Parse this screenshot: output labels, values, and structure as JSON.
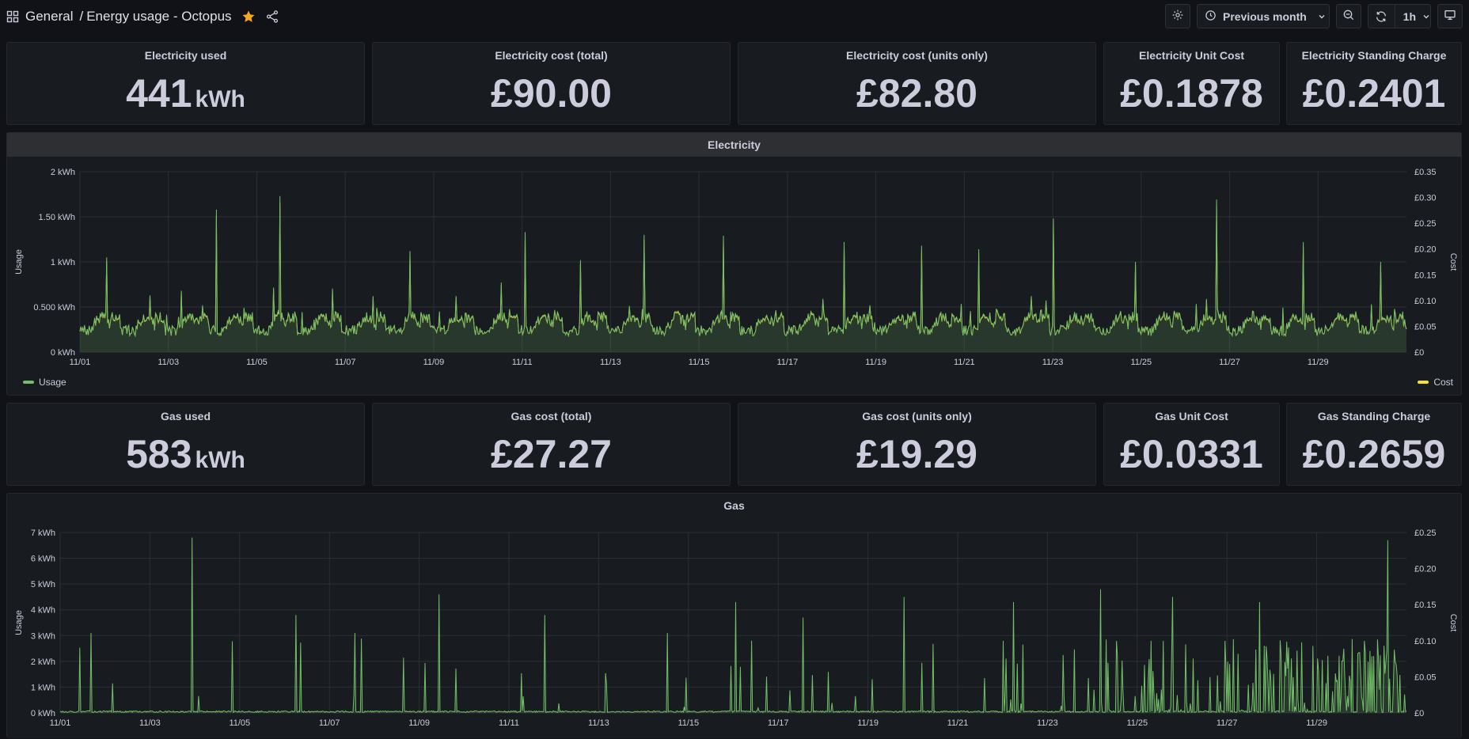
{
  "header": {
    "folder": "General",
    "separator": "/",
    "dashboard_title": "Energy usage - Octopus",
    "time_range_label": "Previous month",
    "refresh_interval": "1h",
    "icons": [
      "grid-icon",
      "star-icon",
      "share-icon",
      "gear-icon",
      "clock-icon",
      "zoom-out-icon",
      "refresh-icon",
      "tv-icon"
    ],
    "star_color": "#f5a623"
  },
  "electricity_stats": [
    {
      "title": "Electricity used",
      "value": "441",
      "unit": "kWh"
    },
    {
      "title": "Electricity cost (total)",
      "value": "£90.00",
      "unit": ""
    },
    {
      "title": "Electricity cost (units only)",
      "value": "£82.80",
      "unit": ""
    },
    {
      "title": "Electricity Unit Cost",
      "value": "£0.1878",
      "unit": ""
    },
    {
      "title": "Electricity Standing Charge",
      "value": "£0.2401",
      "unit": ""
    }
  ],
  "gas_stats": [
    {
      "title": "Gas used",
      "value": "583",
      "unit": "kWh"
    },
    {
      "title": "Gas cost (total)",
      "value": "£27.27",
      "unit": ""
    },
    {
      "title": "Gas cost (units only)",
      "value": "£19.29",
      "unit": ""
    },
    {
      "title": "Gas Unit Cost",
      "value": "£0.0331",
      "unit": ""
    },
    {
      "title": "Gas Standing Charge",
      "value": "£0.2659",
      "unit": ""
    }
  ],
  "colors": {
    "usage": "#73bf69",
    "cost": "#fade2a",
    "usage_fill": "rgba(115,191,105,0.18)"
  },
  "chart_data": [
    {
      "type": "area",
      "title": "Electricity",
      "xlabel": "",
      "ylabel": "Usage",
      "ylabel_right": "Cost",
      "x_range": [
        "11/01",
        "11/30"
      ],
      "x_ticks": [
        "11/01",
        "11/03",
        "11/05",
        "11/07",
        "11/09",
        "11/11",
        "11/13",
        "11/15",
        "11/17",
        "11/19",
        "11/21",
        "11/23",
        "11/25",
        "11/27",
        "11/29"
      ],
      "y_ticks": [
        "0 kWh",
        "0.500 kWh",
        "1 kWh",
        "1.50 kWh",
        "2 kWh"
      ],
      "ylim": [
        0,
        2
      ],
      "y2_ticks": [
        "£0",
        "£0.05",
        "£0.10",
        "£0.15",
        "£0.20",
        "£0.25",
        "£0.30",
        "£0.35"
      ],
      "y2lim": [
        0,
        0.35
      ],
      "legend_placement": "bottom",
      "series": [
        {
          "name": "Usage",
          "axis": "left",
          "color": "#73bf69",
          "baseline": 0.3,
          "peaks_kwh": [
            1.05,
            1.58,
            1.73,
            0.62,
            1.12,
            1.33,
            1.02,
            1.3,
            1.29,
            1.22,
            1.18,
            1.14,
            1.48,
            1.0,
            1.69,
            1.22,
            1.0
          ]
        },
        {
          "name": "Cost",
          "axis": "right",
          "color": "#fade2a"
        }
      ]
    },
    {
      "type": "area",
      "title": "Gas",
      "xlabel": "",
      "ylabel": "Usage",
      "ylabel_right": "Cost",
      "x_range": [
        "11/01",
        "11/30"
      ],
      "x_ticks": [
        "11/01",
        "11/03",
        "11/05",
        "11/07",
        "11/09",
        "11/11",
        "11/13",
        "11/15",
        "11/17",
        "11/19",
        "11/21",
        "11/23",
        "11/25",
        "11/27",
        "11/29"
      ],
      "y_ticks": [
        "0 kWh",
        "1 kWh",
        "2 kWh",
        "3 kWh",
        "4 kWh",
        "5 kWh",
        "6 kWh",
        "7 kWh"
      ],
      "ylim": [
        0,
        7
      ],
      "y2_ticks": [
        "£0",
        "£0.05",
        "£0.10",
        "£0.15",
        "£0.20",
        "£0.25"
      ],
      "y2lim": [
        0,
        0.25
      ],
      "series": [
        {
          "name": "Usage",
          "axis": "left",
          "color": "#73bf69",
          "peaks_kwh": [
            3.1,
            6.8,
            3.8,
            3.1,
            4.6,
            3.8,
            3.1,
            4.3,
            3.7,
            4.5,
            4.3,
            4.8,
            4.5,
            4.3,
            6.7
          ]
        }
      ]
    }
  ]
}
